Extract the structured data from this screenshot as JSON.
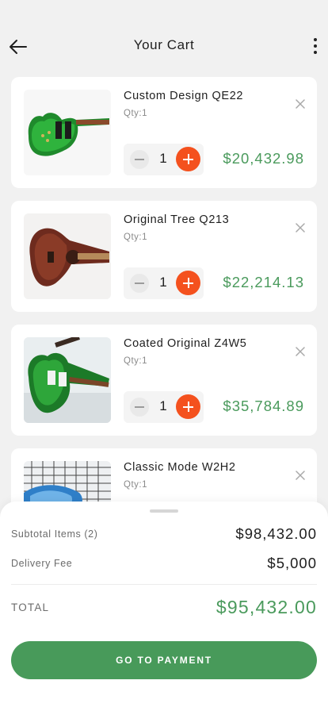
{
  "header": {
    "title": "Your Cart"
  },
  "cart": {
    "items": [
      {
        "name": "Custom Design QE22",
        "qty_label": "Qty:1",
        "qty": "1",
        "price": "$20,432.98"
      },
      {
        "name": "Original Tree Q213",
        "qty_label": "Qty:1",
        "qty": "1",
        "price": "$22,214.13"
      },
      {
        "name": "Coated Original Z4W5",
        "qty_label": "Qty:1",
        "qty": "1",
        "price": "$35,784.89"
      },
      {
        "name": "Classic Mode W2H2",
        "qty_label": "Qty:1"
      }
    ]
  },
  "summary": {
    "subtotal_label": "Subtotal Items (2)",
    "subtotal_value": "$98,432.00",
    "delivery_label": "Delivery Fee",
    "delivery_value": "$5,000",
    "total_label": "TOTAL",
    "total_value": "$95,432.00",
    "pay_button": "GO TO PAYMENT"
  },
  "colors": {
    "accent_green": "#489a5a",
    "price_green": "#4a9a5c",
    "plus_orange": "#f4511e"
  },
  "icons": [
    "arrow-left-icon",
    "more-vertical-icon",
    "close-icon",
    "minus-icon",
    "plus-icon",
    "drag-handle-icon"
  ]
}
